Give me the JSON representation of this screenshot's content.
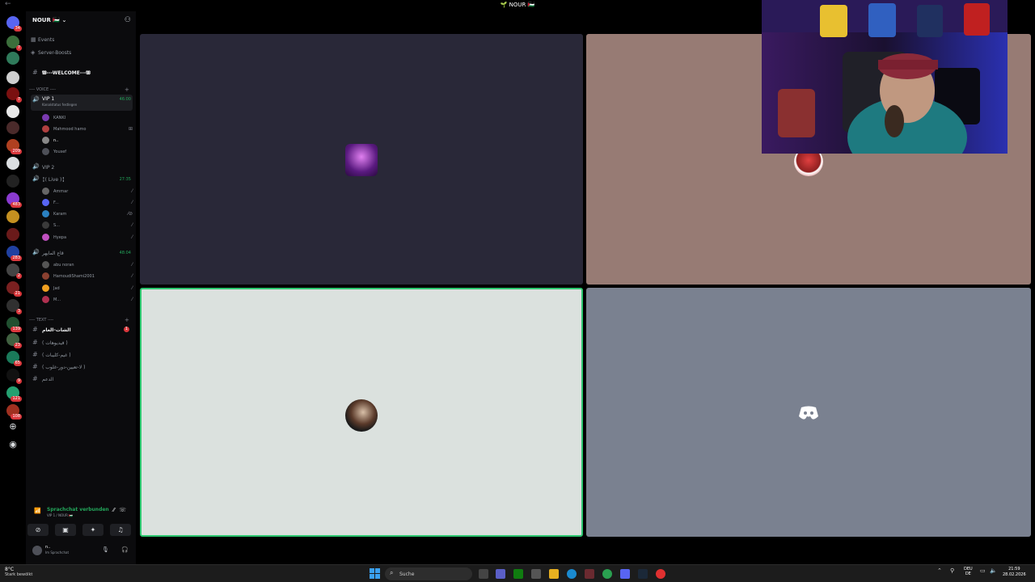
{
  "window": {
    "title": "🌱 NOUR 🇵🇸"
  },
  "server": {
    "name": "NOUR 🇵🇸"
  },
  "rail": {
    "badges": [
      "34",
      "7",
      "7",
      "483",
      "209",
      "283",
      "2",
      "21",
      "3",
      "139",
      "23",
      "65",
      "9",
      "121",
      "108"
    ]
  },
  "sidebar": {
    "top_items": [
      {
        "icon": "calendar-icon",
        "label": "Events"
      },
      {
        "icon": "boost-icon",
        "label": "Server-Boosts"
      }
    ],
    "welcome_channel": "𝖂---WELCOME---𝖂",
    "voice_category": "---- VOICE ----",
    "voice_channels": [
      {
        "label": "VIP 1",
        "time": "46:00",
        "status": "Kanalstatus festlegen",
        "active": true
      },
      {
        "label": "VIP 2"
      },
      {
        "label": "╏( Live )╏",
        "time": "27:35"
      },
      {
        "label": "قاع المايهر",
        "time": "48:04"
      }
    ],
    "vip1_users": [
      "KANKI",
      "Mahmood hamo",
      "n..",
      "Yousef"
    ],
    "live_users": [
      "Ammar",
      "F...",
      "Karam",
      "S...",
      "Hyepa"
    ],
    "qaa_users": [
      "abu noran",
      "HamoudiShami2001",
      "Jad",
      "M..."
    ],
    "text_category": "---- TEXT ----",
    "text_channels": [
      {
        "label": "الشات-العام",
        "unread": "1"
      },
      {
        "label": "( فيديوهات )"
      },
      {
        "label": "( غيم-كليبات )"
      },
      {
        "label": "( لا-تعيين-دور-غلوب )"
      },
      {
        "label": "الدعم"
      }
    ]
  },
  "voice_status": {
    "connected": "Sprachchat verbunden",
    "location": "VIP 1 / NOUR 🇵🇸"
  },
  "user_panel": {
    "name": "n..",
    "status": "Im Sprachchat"
  },
  "taskbar": {
    "temperature": "8°C",
    "condition": "Stark bewölkt",
    "search_placeholder": "Suche",
    "lang_top": "DEU",
    "lang_bottom": "DE",
    "time": "21:59",
    "date": "28.02.2026"
  }
}
